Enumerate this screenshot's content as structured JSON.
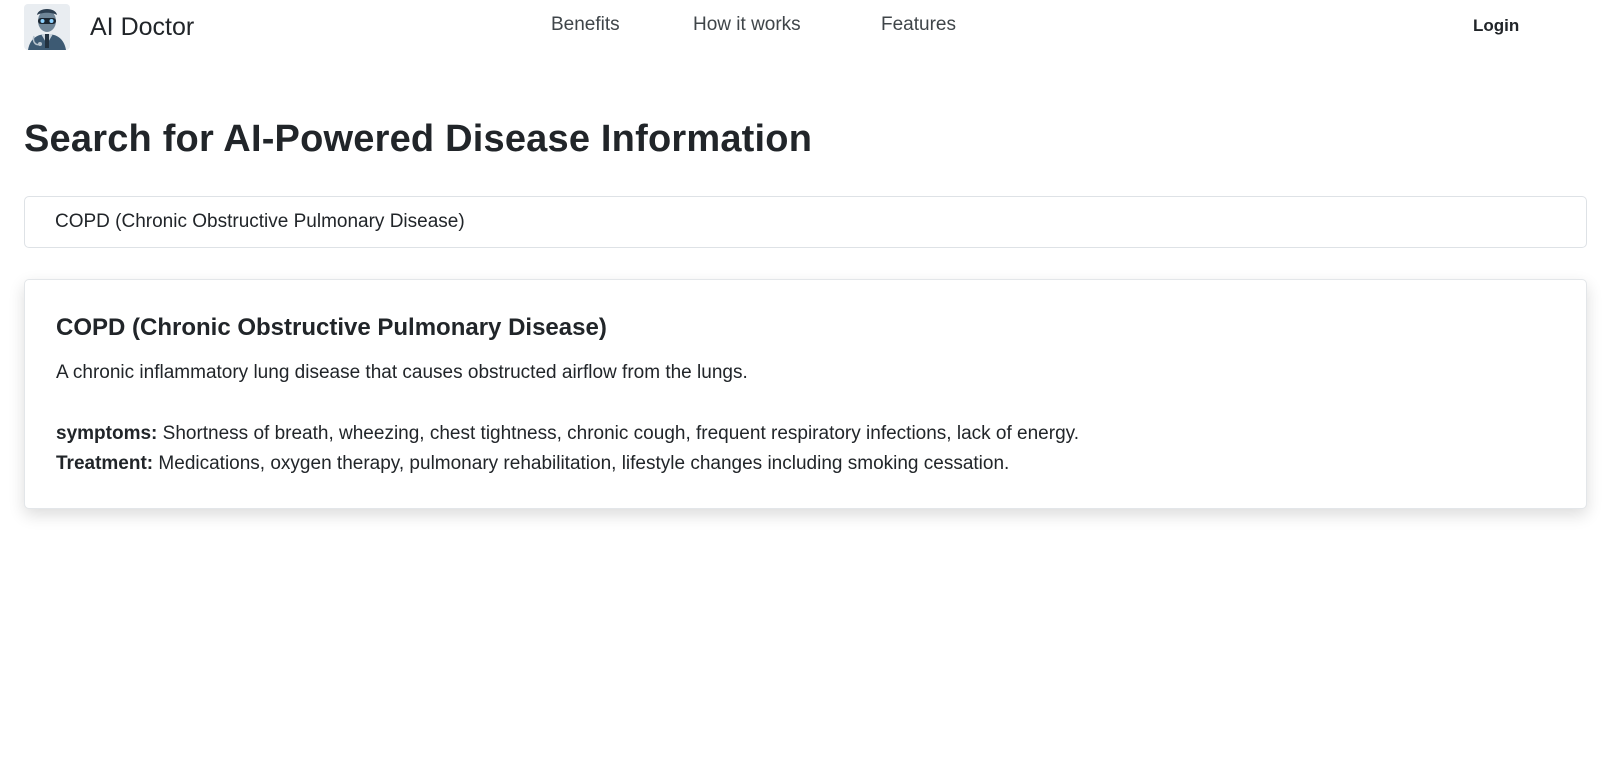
{
  "brand": {
    "name": "AI Doctor",
    "logo_icon": "doctor-robot-avatar"
  },
  "nav": {
    "links": [
      "Benefits",
      "How it works",
      "Features"
    ],
    "login_label": "Login"
  },
  "main": {
    "title": "Search for AI-Powered Disease Information",
    "search": {
      "value": "COPD (Chronic Obstructive Pulmonary Disease)"
    },
    "result": {
      "name": "COPD (Chronic Obstructive Pulmonary Disease)",
      "description": "A chronic inflammatory lung disease that causes obstructed airflow from the lungs.",
      "symptoms_label": "symptoms:",
      "symptoms": "Shortness of breath, wheezing, chest tightness, chronic cough, frequent respiratory infections, lack of energy.",
      "treatment_label": "Treatment:",
      "treatment": "Medications, oxygen therapy, pulmonary rehabilitation, lifestyle changes including smoking cessation."
    }
  },
  "colors": {
    "text": "#212529",
    "nav_text": "#3f4549",
    "border": "#dee2e6",
    "background": "#ffffff"
  }
}
